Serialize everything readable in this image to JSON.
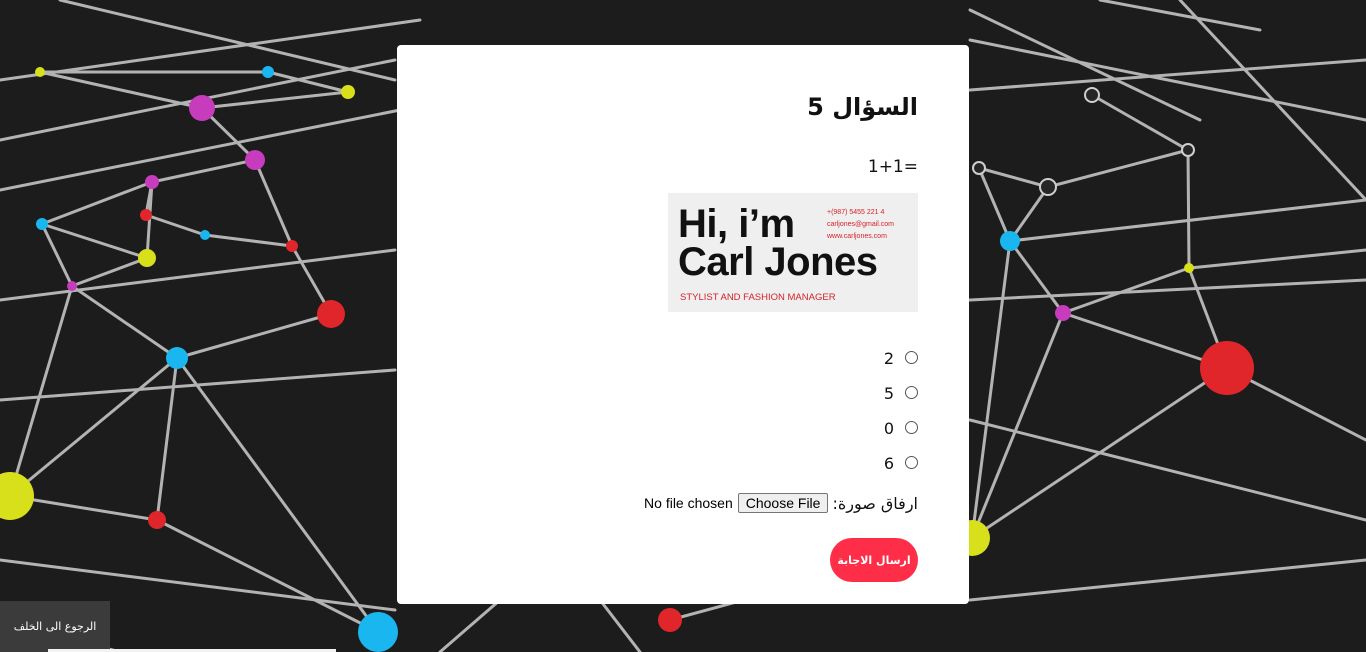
{
  "question": {
    "title": "السؤال 5",
    "text": "1+1="
  },
  "image": {
    "headline_line1": "Hi, i’m",
    "headline_line2": "Carl Jones",
    "phone": "+(987) 5455 221 4",
    "email": "carljones@gmail.com",
    "website": "www.carljones.com",
    "role": "STYLIST AND FASHION MANAGER"
  },
  "options": [
    {
      "label": "2"
    },
    {
      "label": "5"
    },
    {
      "label": "0"
    },
    {
      "label": "6"
    }
  ],
  "upload": {
    "label": "ارفاق صورة:",
    "button": "Choose File",
    "status": "No file chosen"
  },
  "submit_label": "ارسال الاجابة",
  "back_label": "الرجوع الى الخلف",
  "colors": {
    "accent": "#ff2e48",
    "card_text_red": "#d6222a",
    "background": "#1c1c1c",
    "back_button": "#3b3b3b"
  }
}
